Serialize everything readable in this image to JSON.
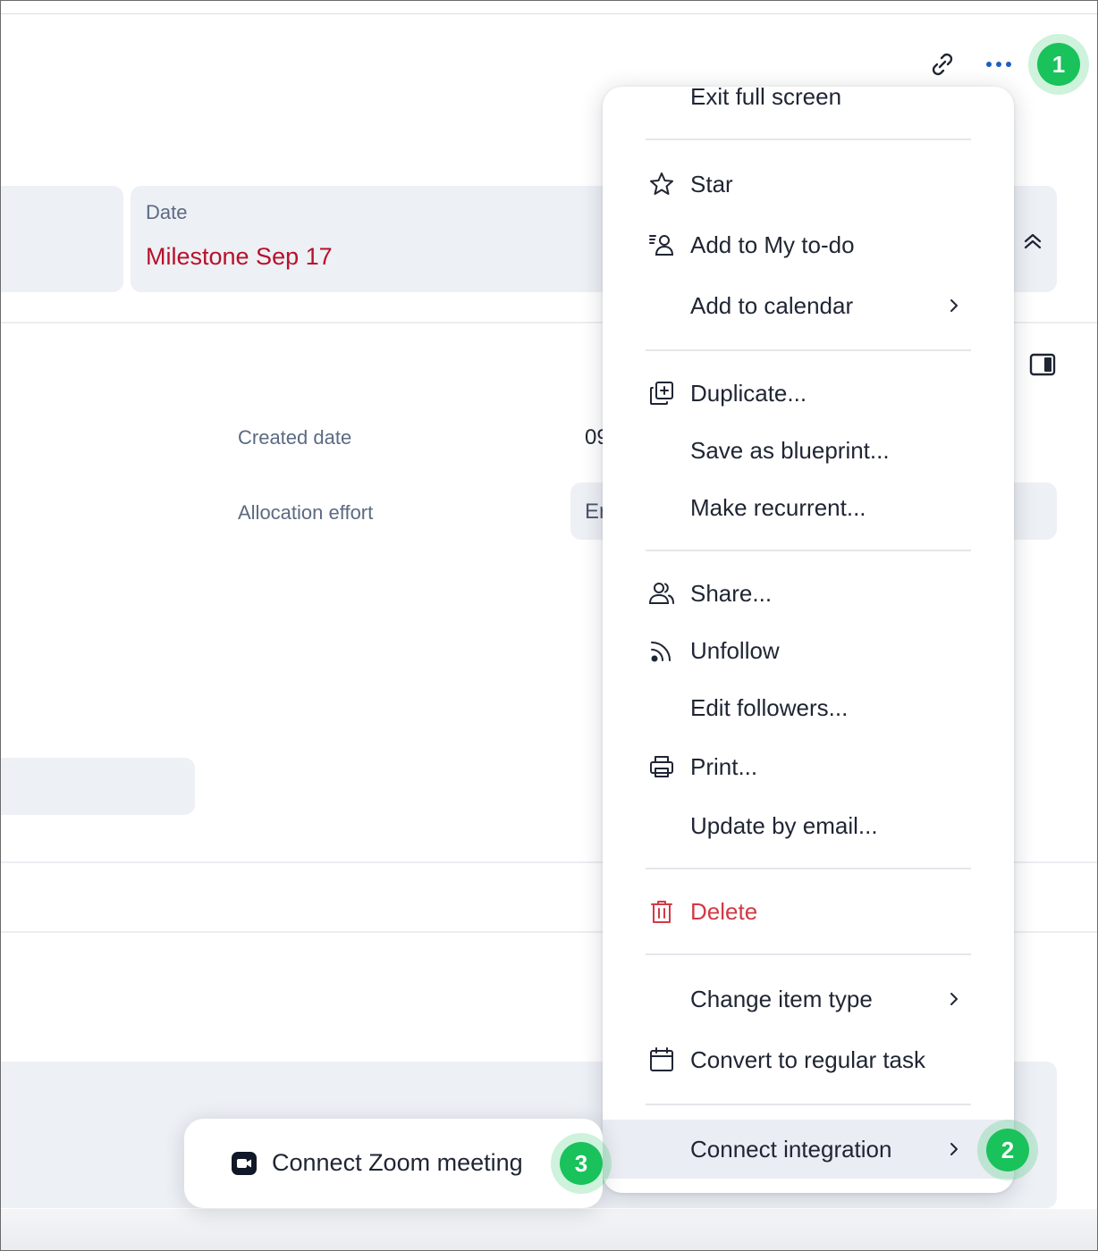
{
  "header": {
    "link_icon": "link-icon",
    "more_icon": "more-horizontal-icon"
  },
  "badges": [
    "1",
    "2",
    "3"
  ],
  "fields": {
    "date_label": "Date",
    "date_value": "Milestone Sep 17",
    "created_label": "Created date",
    "created_value_partial": "09",
    "allocation_label": "Allocation effort",
    "allocation_value_partial": "Er"
  },
  "menu": {
    "exit_full_screen": "Exit full screen",
    "star": "Star",
    "add_to_my_todo": "Add to My to-do",
    "add_to_calendar": "Add to calendar",
    "duplicate": "Duplicate...",
    "save_as_blueprint": "Save as blueprint...",
    "make_recurrent": "Make recurrent...",
    "share": "Share...",
    "unfollow": "Unfollow",
    "edit_followers": "Edit followers...",
    "print": "Print...",
    "update_by_email": "Update by email...",
    "delete": "Delete",
    "change_item_type": "Change item type",
    "convert_to_regular_task": "Convert to regular task",
    "connect_integration": "Connect integration"
  },
  "submenu": {
    "connect_zoom_meeting": "Connect Zoom meeting"
  },
  "colors": {
    "badge_green": "#19c25a",
    "danger_red": "#d13a45",
    "date_red": "#b8102a",
    "accent_blue": "#1f5fbf"
  }
}
